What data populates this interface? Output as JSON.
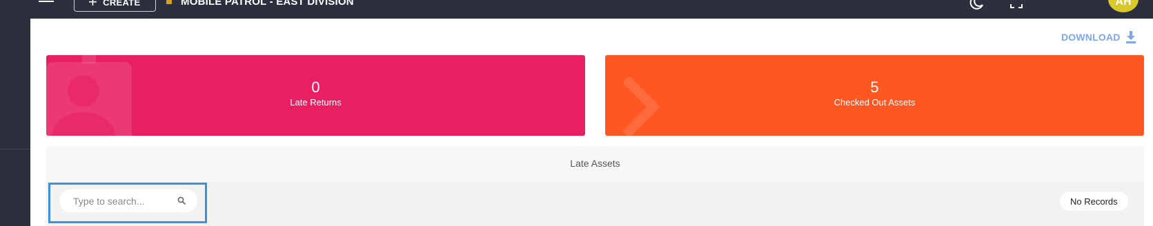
{
  "topbar": {
    "create_label": "CREATE",
    "division_title": "MOBILE PATROL - EAST DIVISION",
    "avatar_initials": "AH",
    "icons": [
      "menu-icon",
      "plus-icon",
      "building-icon",
      "moon-icon",
      "fullscreen-icon"
    ]
  },
  "actions": {
    "download_label": "DOWNLOAD",
    "download_icon": "download-icon"
  },
  "cards": {
    "late_returns": {
      "value": "0",
      "label": "Late Returns",
      "color": "#e91e63",
      "icon": "person-badge-icon"
    },
    "checked_out": {
      "value": "5",
      "label": "Checked Out Assets",
      "color": "#ff5722",
      "icon": "chevron-right-icon"
    }
  },
  "late_assets": {
    "title": "Late Assets",
    "search_placeholder": "Type to search...",
    "search_value": "",
    "records_status": "No Records"
  },
  "colors": {
    "topbar": "#2c2f3e",
    "accent_link": "#7fa7e8",
    "focus_outline": "#3d8fe0",
    "avatar": "#d8c82a"
  }
}
